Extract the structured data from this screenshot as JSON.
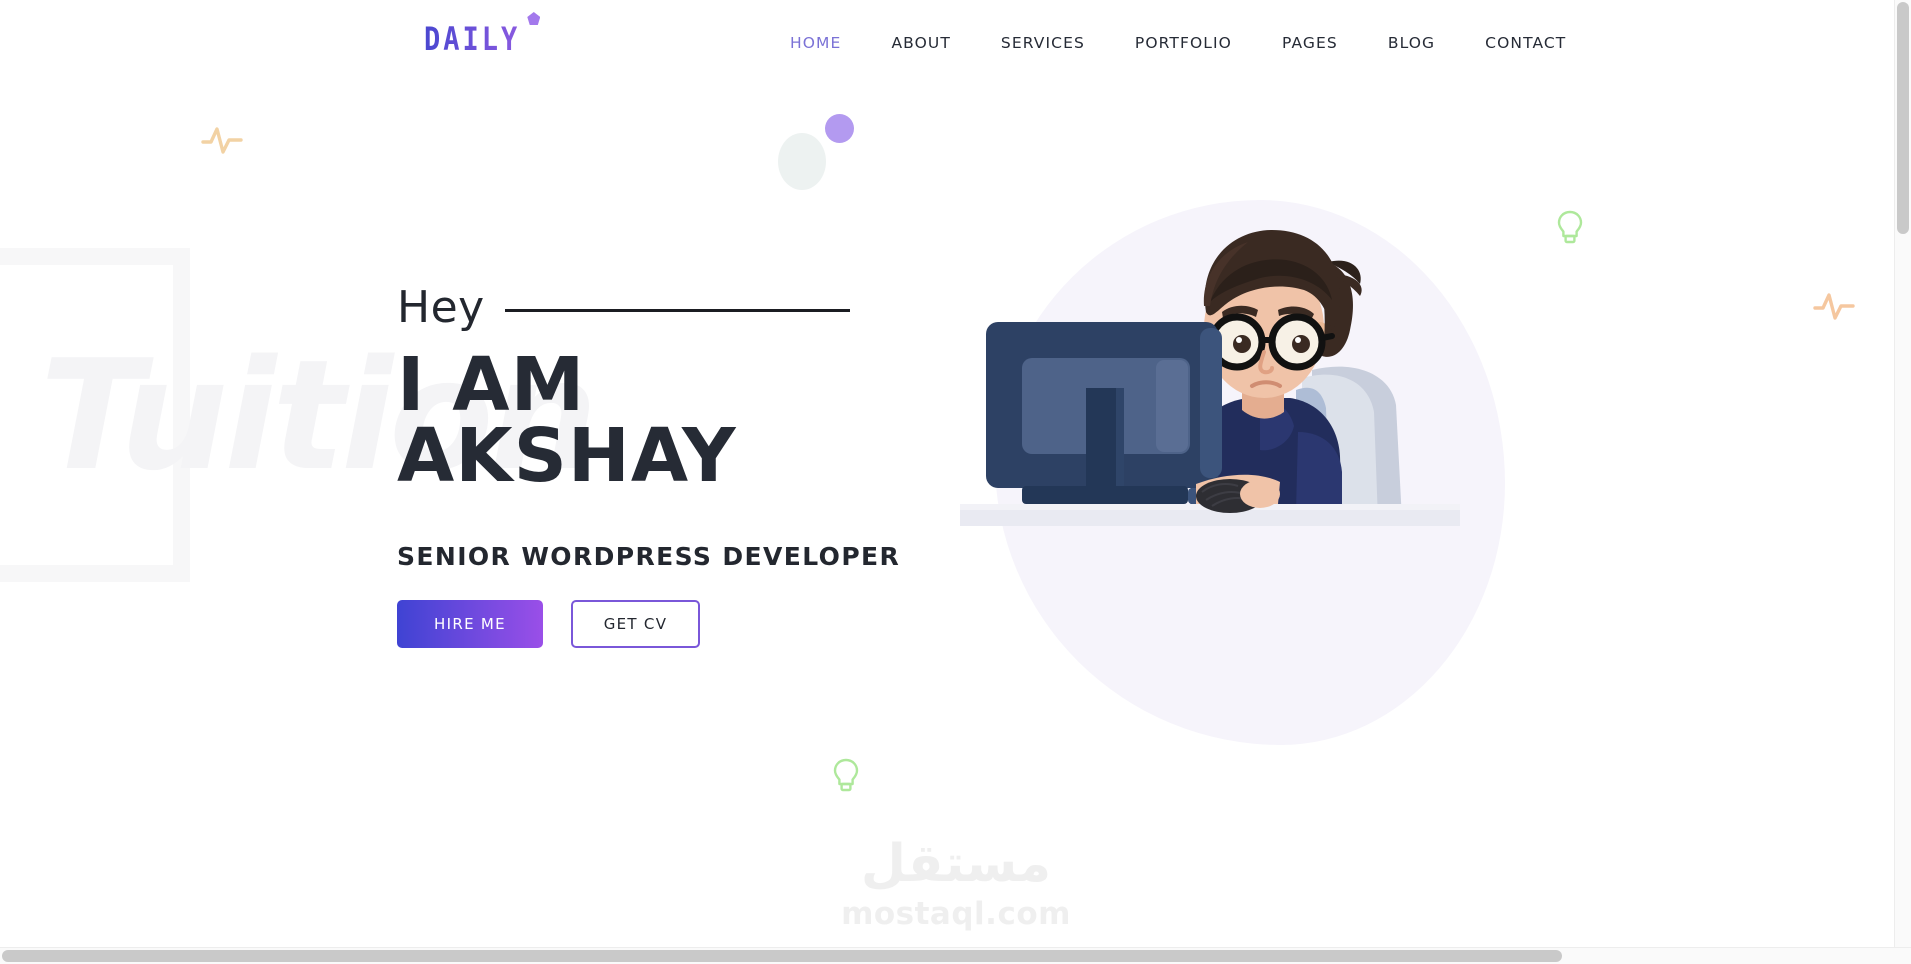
{
  "header": {
    "logo_text": "DAILY",
    "logo_accent_color": "#a379ec",
    "logo_gradient_from": "#4a47d0",
    "logo_gradient_to": "#8a5ae0",
    "nav": [
      {
        "label": "HOME",
        "active": true
      },
      {
        "label": "ABOUT",
        "active": false
      },
      {
        "label": "SERVICES",
        "active": false
      },
      {
        "label": "PORTFOLIO",
        "active": false
      },
      {
        "label": "PAGES",
        "active": false
      },
      {
        "label": "BLOG",
        "active": false
      },
      {
        "label": "CONTACT",
        "active": false
      }
    ],
    "active_link_color": "#7b72d6",
    "link_color": "#262b36"
  },
  "hero": {
    "greeting": "Hey",
    "name_line1": "I AM",
    "name_line2": "AKSHAY",
    "role": "SENIOR WORDPRESS DEVELOPER",
    "primary_button": "HIRE ME",
    "secondary_button": "GET CV",
    "primary_gradient_from": "#3f43d3",
    "primary_gradient_to": "#9a4fe8",
    "secondary_border_color": "#7a57d9",
    "heading_color": "#262b35",
    "background_watermark": "Tuition"
  },
  "decorations": {
    "pulse_icon_left": "pulse-wave-icon",
    "pulse_icon_right": "pulse-wave-icon",
    "bulb_icon_right": "light-bulb-icon",
    "bulb_icon_bottom": "light-bulb-icon",
    "oval_shape": "mint-oval",
    "circle_shape": "purple-circle",
    "pulse_color": "#f2d2a4",
    "bulb_color": "#aee89b",
    "oval_color": "#edf2f1",
    "circle_color": "#b39af0",
    "blob_color": "#f6f4fb"
  },
  "illustration": {
    "alt": "developer-at-desk-illustration",
    "hair_color": "#3a2a22",
    "skin_color": "#f0c3a8",
    "shirt_color": "#222d5c",
    "monitor_color": "#2d4164",
    "monitor_inner_color": "#4e6389",
    "monitor_stand_color": "#233757",
    "chair_color": "#d6dbe6",
    "desk_color": "#e9eaf2"
  },
  "watermark": {
    "arabic": "مستقل",
    "latin": "mostaql.com",
    "color": "#efefef"
  }
}
